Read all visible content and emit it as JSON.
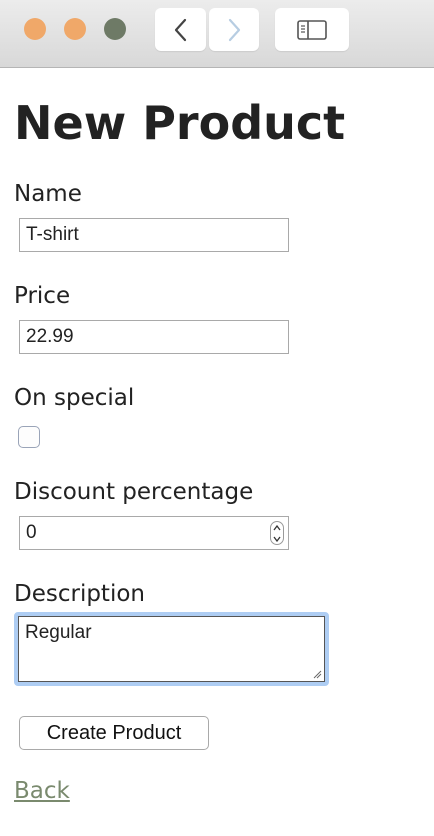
{
  "window": {
    "traffic_lights": [
      "close",
      "minimize",
      "zoom"
    ],
    "icons": {
      "back": "chevron-left-icon",
      "forward": "chevron-right-icon",
      "sidebar": "sidebar-icon"
    }
  },
  "page": {
    "title": "New Product"
  },
  "form": {
    "name_label": "Name",
    "name_value": "T-shirt",
    "price_label": "Price",
    "price_value": "22.99",
    "on_special_label": "On special",
    "on_special_checked": false,
    "discount_label": "Discount percentage",
    "discount_value": "0",
    "description_label": "Description",
    "description_value": "Regular",
    "submit_label": "Create Product"
  },
  "nav": {
    "back_link": "Back"
  }
}
